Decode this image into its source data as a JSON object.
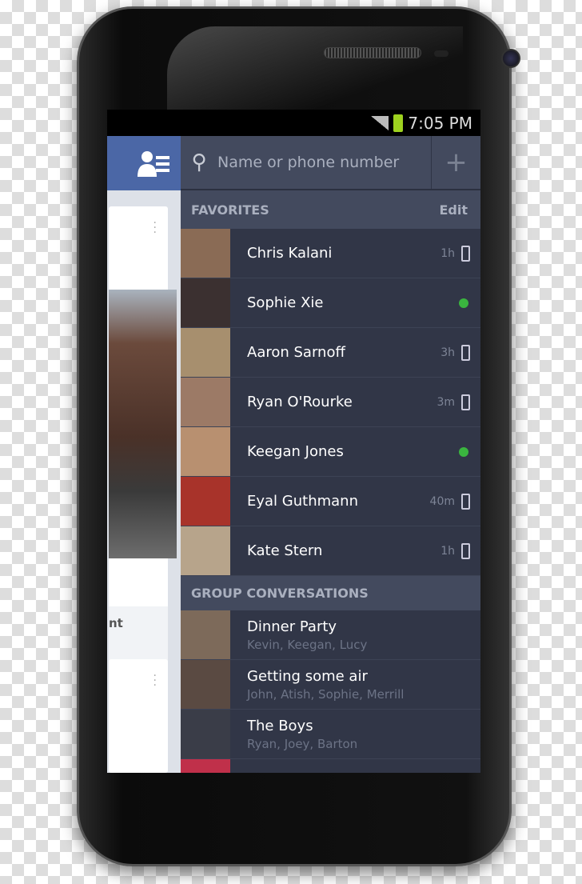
{
  "status_bar": {
    "time": "7:05 PM",
    "battery_color": "#9ed21f"
  },
  "left_panel": {
    "icon": "contacts-list-icon",
    "card_text": "nt",
    "header_color": "#4b67a6"
  },
  "search": {
    "placeholder": "Name or phone number",
    "add_icon": "plus-icon"
  },
  "favorites": {
    "title": "FAVORITES",
    "edit_label": "Edit",
    "items": [
      {
        "name": "Chris Kalani",
        "time": "1h",
        "status": "mobile",
        "avatar_color": "#8a6b55"
      },
      {
        "name": "Sophie Xie",
        "time": "",
        "status": "online",
        "avatar_color": "#3b3030"
      },
      {
        "name": "Aaron Sarnoff",
        "time": "3h",
        "status": "mobile",
        "avatar_color": "#a78f6e"
      },
      {
        "name": "Ryan O'Rourke",
        "time": "3m",
        "status": "mobile",
        "avatar_color": "#9c7a66"
      },
      {
        "name": "Keegan Jones",
        "time": "",
        "status": "online",
        "avatar_color": "#b89070"
      },
      {
        "name": "Eyal Guthmann",
        "time": "40m",
        "status": "mobile",
        "avatar_color": "#a8332a"
      },
      {
        "name": "Kate Stern",
        "time": "1h",
        "status": "mobile",
        "avatar_color": "#b7a48b"
      }
    ]
  },
  "groups": {
    "title": "GROUP CONVERSATIONS",
    "items": [
      {
        "name": "Dinner Party",
        "members": "Kevin, Keegan, Lucy",
        "avatar_color": "#7d6a5a"
      },
      {
        "name": "Getting some air",
        "members": "John, Atish, Sophie, Merrill",
        "avatar_color": "#5a4a42"
      },
      {
        "name": "The Boys",
        "members": "Ryan, Joey, Barton",
        "avatar_color": "#3a3d48"
      }
    ]
  },
  "online_color": "#3ab53f"
}
